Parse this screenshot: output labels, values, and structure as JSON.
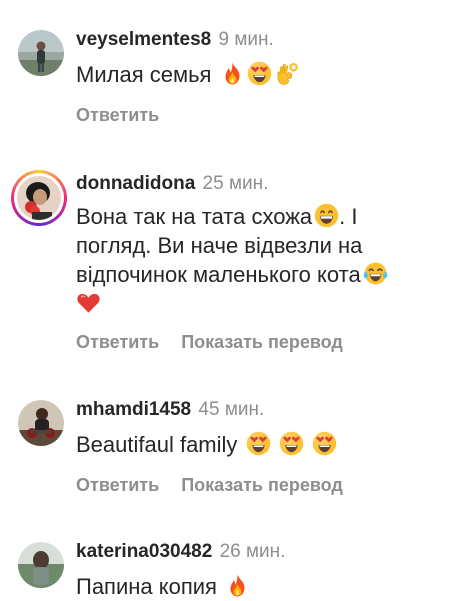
{
  "comments": [
    {
      "username": "veyselmentes8",
      "time": "9 мин.",
      "text": "Милая семья",
      "emojis": [
        "fire-emoji",
        "heart-eyes-emoji",
        "ok-hand-emoji"
      ],
      "reply_label": "Ответить"
    },
    {
      "username": "donnadidona",
      "time": "25 мин.",
      "text_line1": "Вона так на тата схожа",
      "text_line1_tail": ". І",
      "text_line2": "погляд. Ви наче відвезли на",
      "text_line3": "відпочинок маленького кота",
      "emojis": [
        "grinning-emoji",
        "joy-emoji",
        "red-heart-emoji"
      ],
      "reply_label": "Ответить",
      "translate_label": "Показать перевод",
      "story_ring": true
    },
    {
      "username": "mhamdi1458",
      "time": "45 мин.",
      "text": "Beautifaul family",
      "emojis": [
        "heart-eyes-emoji",
        "heart-eyes-emoji",
        "heart-eyes-emoji"
      ],
      "reply_label": "Ответить",
      "translate_label": "Показать перевод"
    },
    {
      "username": "katerina030482",
      "time": "26 мин.",
      "text": "Папина копия",
      "emojis": [
        "fire-emoji"
      ]
    }
  ],
  "colors": {
    "username": "#262626",
    "meta": "#8e8e8e",
    "story_ring": [
      "#f9ce34",
      "#ee2a7b",
      "#6228d7"
    ]
  }
}
